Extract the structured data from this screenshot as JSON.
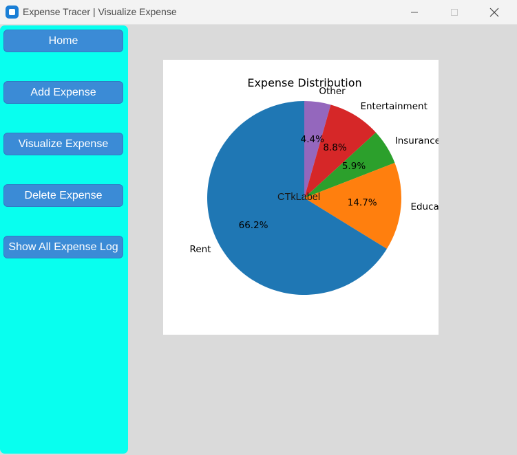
{
  "window": {
    "title": "Expense Tracer | Visualize Expense",
    "controls": [
      "minimize",
      "maximize",
      "close"
    ]
  },
  "sidebar": {
    "background": "#08ffef",
    "button_color": "#3b8bd6",
    "items": [
      {
        "label": "Home"
      },
      {
        "label": "Add Expense"
      },
      {
        "label": "Visualize Expense"
      },
      {
        "label": "Delete Expense"
      },
      {
        "label": "Show All Expense Log"
      }
    ]
  },
  "main": {
    "overlay_label": "CTkLabel"
  },
  "chart_data": {
    "type": "pie",
    "title": "Expense Distribution",
    "start_angle_deg": 90,
    "direction": "clockwise",
    "slices": [
      {
        "label": "Other",
        "value": 4.4,
        "pct_label": "4.4%",
        "color": "#9467bd"
      },
      {
        "label": "Entertainment",
        "value": 8.8,
        "pct_label": "8.8%",
        "color": "#d62728"
      },
      {
        "label": "Insurance",
        "value": 5.9,
        "pct_label": "5.9%",
        "color": "#2ca02c"
      },
      {
        "label": "Educa",
        "value": 14.7,
        "pct_label": "14.7%",
        "color": "#ff7f0e"
      },
      {
        "label": "Rent",
        "value": 66.2,
        "pct_label": "66.2%",
        "color": "#1f77b4"
      }
    ]
  }
}
